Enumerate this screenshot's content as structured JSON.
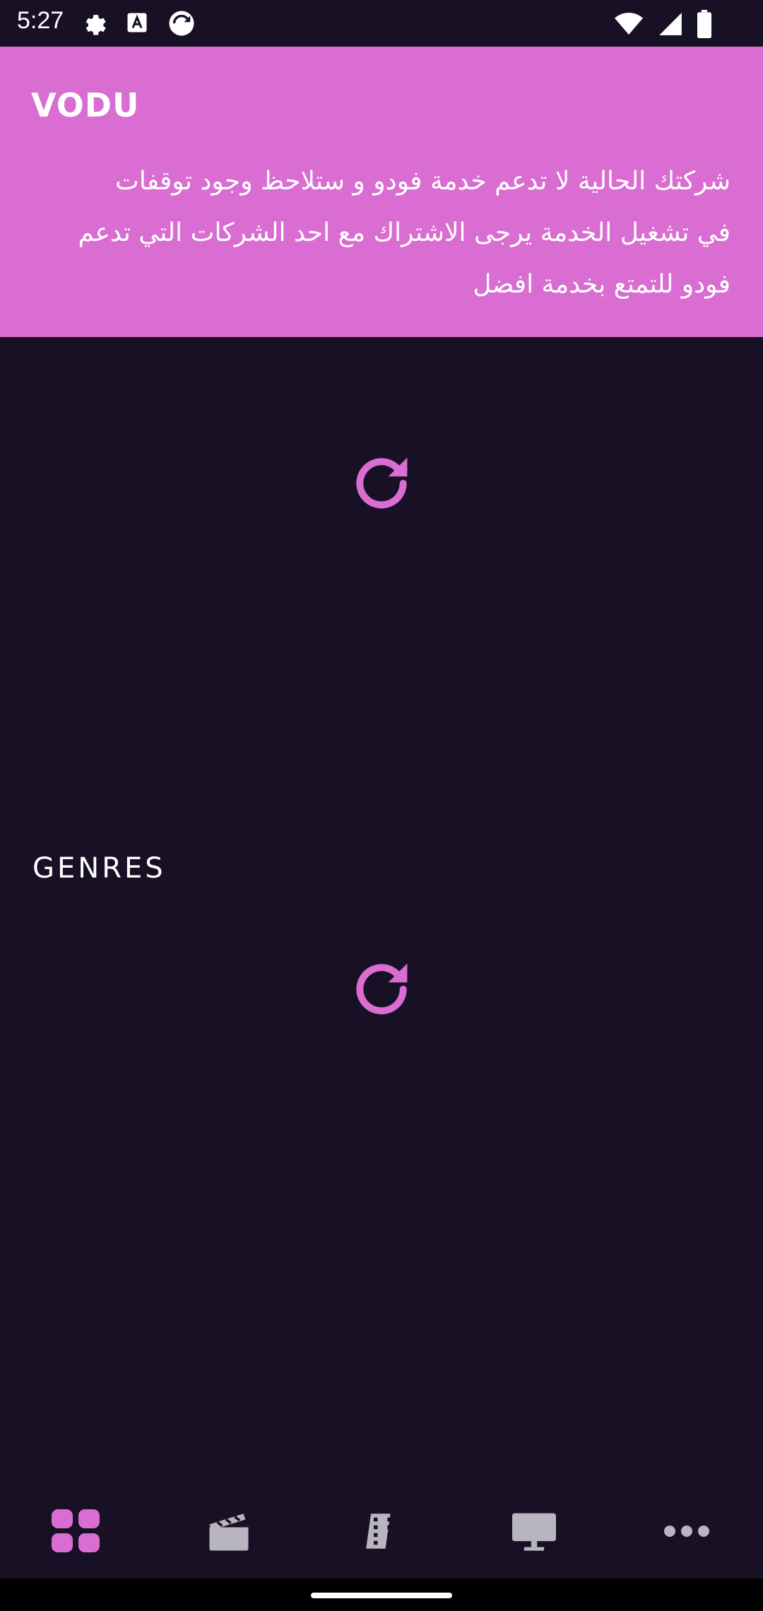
{
  "status_bar": {
    "time": "5:27",
    "left_icons": [
      "settings-icon",
      "font-a-icon",
      "vpn-app-icon"
    ],
    "right_icons": [
      "wifi-icon",
      "signal-icon",
      "battery-icon"
    ]
  },
  "banner": {
    "logo": "VODU",
    "message_lines": [
      "شركتك الحالية لا تدعم خدمة فودو و ستلاحظ وجود توقفات",
      "في تشغيل الخدمة يرجى الاشتراك مع احد الشركات التي تدعم",
      "فودو للتمتع بخدمة افضل"
    ],
    "background": "#d96dd1"
  },
  "sections": {
    "genres_label": "GENRES"
  },
  "bottom_nav": {
    "items": [
      {
        "icon": "grid-icon",
        "active": true
      },
      {
        "icon": "clapperboard-icon",
        "active": false
      },
      {
        "icon": "film-strip-icon",
        "active": false
      },
      {
        "icon": "tv-monitor-icon",
        "active": false
      },
      {
        "icon": "more-icon",
        "active": false
      }
    ]
  },
  "colors": {
    "background": "#181025",
    "accent": "#d96dd1",
    "inactive_icon": "#b8b4c0"
  }
}
